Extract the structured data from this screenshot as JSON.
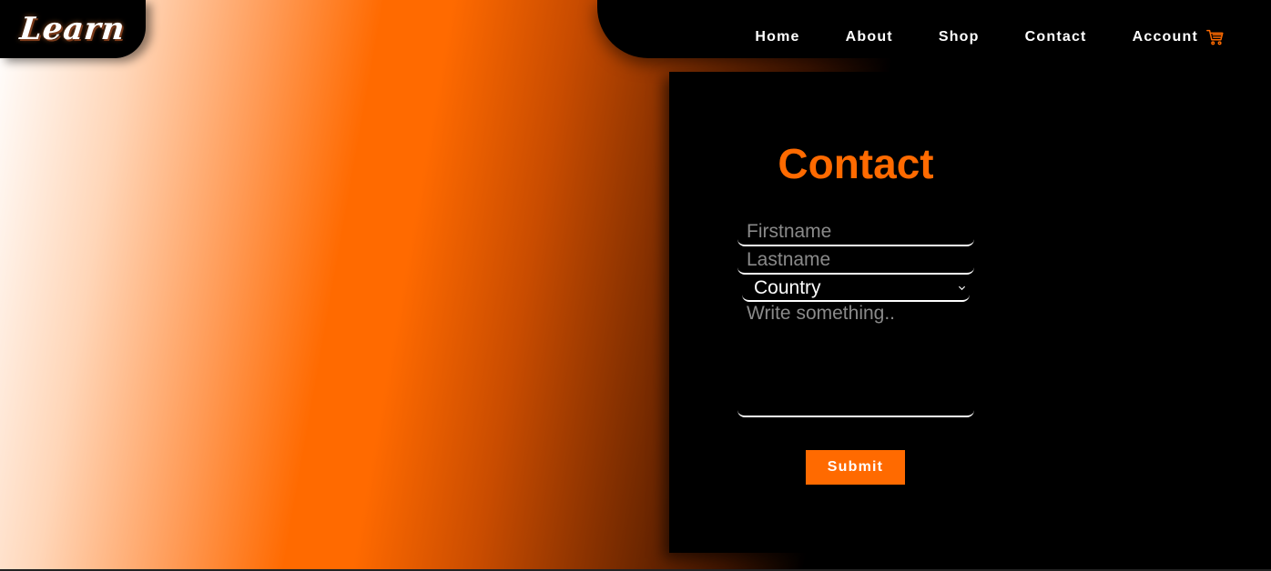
{
  "brand": {
    "logo_text": "Learn"
  },
  "nav": {
    "items": [
      {
        "label": "Home"
      },
      {
        "label": "About"
      },
      {
        "label": "Shop"
      },
      {
        "label": "Contact"
      },
      {
        "label": "Account"
      }
    ],
    "cart_icon": "shopping-cart-icon"
  },
  "contact": {
    "title": "Contact",
    "firstname_placeholder": "Firstname",
    "lastname_placeholder": "Lastname",
    "country_selected": "Country",
    "message_placeholder": "Write something..",
    "submit_label": "Submit"
  },
  "colors": {
    "accent": "#ff6a00",
    "panel": "#000000",
    "text": "#ffffff",
    "placeholder": "#8a8a8a"
  }
}
